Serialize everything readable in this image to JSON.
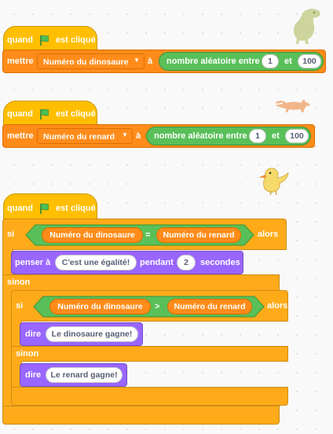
{
  "colors": {
    "events": "#ffbf00",
    "variables": "#ff8c1a",
    "operators": "#59c059",
    "looks": "#9966ff",
    "control": "#ffab19"
  },
  "script1": {
    "hat_when": "quand",
    "hat_clicked": "est cliqué",
    "set_label": "mettre",
    "variable": "Numéro du dinosaure",
    "to_label": "à",
    "random_label": "nombre aléatoire entre",
    "from": "1",
    "and_label": "et",
    "to": "100"
  },
  "script2": {
    "hat_when": "quand",
    "hat_clicked": "est cliqué",
    "set_label": "mettre",
    "variable": "Numéro du renard",
    "to_label": "à",
    "random_label": "nombre aléatoire entre",
    "from": "1",
    "and_label": "et",
    "to": "100"
  },
  "script3": {
    "hat_when": "quand",
    "hat_clicked": "est cliqué",
    "if_label": "si",
    "then_label": "alors",
    "else_label": "sinon",
    "cond1_left": "Numéro du dinosaure",
    "cond1_op": "=",
    "cond1_right": "Numéro du renard",
    "think_label": "penser à",
    "think_text": "C'est une égalité!",
    "for_label": "pendant",
    "secs": "2",
    "secs_label": "secondes",
    "inner_if_label": "si",
    "inner_then_label": "alors",
    "inner_else_label": "sinon",
    "cond2_left": "Numéro du dinosaure",
    "cond2_op": ">",
    "cond2_right": "Numéro du renard",
    "say_label": "dire",
    "say1_text": "Le dinosaure gagne!",
    "say2_text": "Le renard gagne!"
  },
  "sprites": {
    "dino": "dinosaur-sprite",
    "fox": "fox-sprite",
    "bird": "bird-sprite"
  }
}
